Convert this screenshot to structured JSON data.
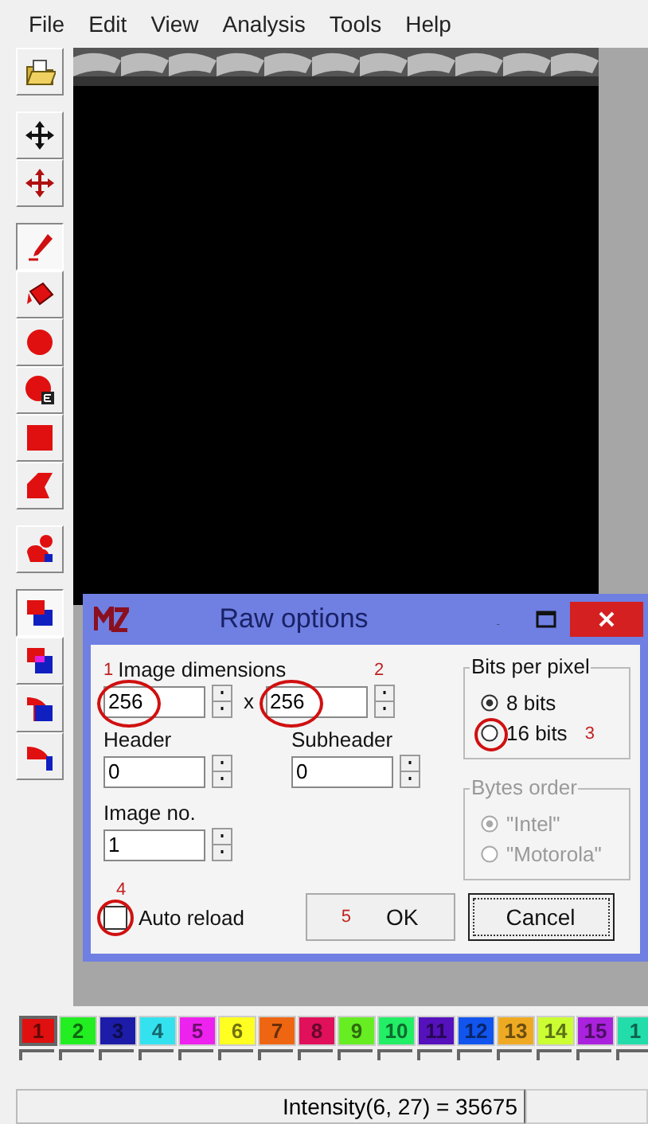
{
  "menu": [
    "File",
    "Edit",
    "View",
    "Analysis",
    "Tools",
    "Help"
  ],
  "tool_groups": [
    {
      "tools": [
        {
          "kind": "open",
          "selected": false
        }
      ]
    },
    {
      "tools": [
        {
          "kind": "move",
          "selected": false
        },
        {
          "kind": "move-red",
          "selected": false
        }
      ]
    },
    {
      "tools": [
        {
          "kind": "pen",
          "selected": true
        },
        {
          "kind": "fill",
          "selected": false
        },
        {
          "kind": "circle",
          "selected": false
        },
        {
          "kind": "circle-e",
          "selected": false
        },
        {
          "kind": "square",
          "selected": false
        },
        {
          "kind": "polygon",
          "selected": false
        }
      ]
    },
    {
      "tools": [
        {
          "kind": "blob",
          "selected": false
        }
      ]
    },
    {
      "tools": [
        {
          "kind": "layer-a",
          "selected": true
        },
        {
          "kind": "layer-b",
          "selected": false
        },
        {
          "kind": "layer-c",
          "selected": false
        },
        {
          "kind": "layer-d",
          "selected": false
        }
      ]
    }
  ],
  "dialog": {
    "title": "Raw options",
    "dimensions": {
      "label": "Image dimensions",
      "mark": "1",
      "times": "x",
      "width": {
        "value": "256",
        "circled": true
      },
      "height": {
        "value": "256",
        "circled": true,
        "mark": "2"
      }
    },
    "header": {
      "label": "Header",
      "value": "0"
    },
    "subheader": {
      "label": "Subheader",
      "value": "0"
    },
    "image_no": {
      "label": "Image no.",
      "value": "1"
    },
    "auto_reload": {
      "label": "Auto reload",
      "checked": false,
      "mark": "4",
      "circled": true
    },
    "bits_per_pixel": {
      "label": "Bits per pixel",
      "disabled": false,
      "options": [
        {
          "label": "8 bits",
          "selected": true
        },
        {
          "label": "16 bits",
          "selected": false,
          "mark": "3",
          "circled": true
        }
      ]
    },
    "bytes_order": {
      "label": "Bytes order",
      "disabled": true,
      "options": [
        {
          "label": "\"Intel\"",
          "selected": true
        },
        {
          "label": "\"Motorola\"",
          "selected": false
        }
      ]
    },
    "buttons": [
      {
        "label": "OK",
        "focused": false,
        "mark": "5"
      },
      {
        "label": "Cancel",
        "focused": true
      }
    ]
  },
  "swatches": [
    {
      "label": "1",
      "color": "#e01010",
      "selected": true
    },
    {
      "label": "2",
      "color": "#22ee22",
      "selected": false
    },
    {
      "label": "3",
      "color": "#1c1ca8",
      "selected": false
    },
    {
      "label": "4",
      "color": "#33e2ee",
      "selected": false
    },
    {
      "label": "5",
      "color": "#ee22ee",
      "selected": false
    },
    {
      "label": "6",
      "color": "#ffff22",
      "selected": false
    },
    {
      "label": "7",
      "color": "#ee6611",
      "selected": false
    },
    {
      "label": "8",
      "color": "#e0105a",
      "selected": false
    },
    {
      "label": "9",
      "color": "#66ee22",
      "selected": false
    },
    {
      "label": "10",
      "color": "#22ee66",
      "selected": false
    },
    {
      "label": "11",
      "color": "#5511bb",
      "selected": false
    },
    {
      "label": "12",
      "color": "#1155ee",
      "selected": false
    },
    {
      "label": "13",
      "color": "#eeaa22",
      "selected": false
    },
    {
      "label": "14",
      "color": "#ccff33",
      "selected": false
    },
    {
      "label": "15",
      "color": "#aa22dd",
      "selected": false
    },
    {
      "label": "1",
      "color": "#22ddaa",
      "selected": false
    }
  ],
  "status_bar": {
    "text": "Intensity(6, 27) = 35675"
  }
}
